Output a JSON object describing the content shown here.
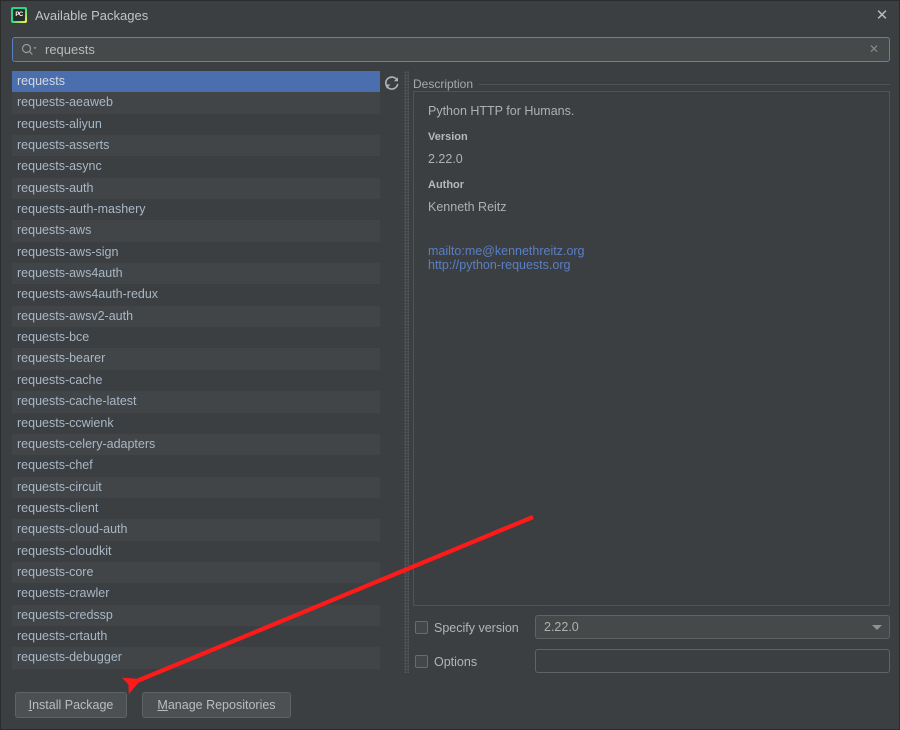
{
  "window": {
    "title": "Available Packages",
    "app_icon": "pycharm-icon",
    "close_icon": "close-icon"
  },
  "search": {
    "icon": "search-icon",
    "value": "requests",
    "placeholder": "",
    "clear_icon": "clear-icon"
  },
  "toolbar": {
    "refresh_icon": "refresh-icon"
  },
  "packages": {
    "selected": "requests",
    "items": [
      "requests",
      "requests-aeaweb",
      "requests-aliyun",
      "requests-asserts",
      "requests-async",
      "requests-auth",
      "requests-auth-mashery",
      "requests-aws",
      "requests-aws-sign",
      "requests-aws4auth",
      "requests-aws4auth-redux",
      "requests-awsv2-auth",
      "requests-bce",
      "requests-bearer",
      "requests-cache",
      "requests-cache-latest",
      "requests-ccwienk",
      "requests-celery-adapters",
      "requests-chef",
      "requests-circuit",
      "requests-client",
      "requests-cloud-auth",
      "requests-cloudkit",
      "requests-core",
      "requests-crawler",
      "requests-credssp",
      "requests-crtauth",
      "requests-debugger"
    ]
  },
  "description": {
    "group_label": "Description",
    "summary": "Python HTTP for Humans.",
    "version_label": "Version",
    "version_value": "2.22.0",
    "author_label": "Author",
    "author_value": "Kenneth Reitz",
    "links": [
      "mailto:me@kennethreitz.org",
      "http://python-requests.org"
    ]
  },
  "options": {
    "specify_version_label": "Specify version",
    "specify_version_checked": false,
    "version_selected": "2.22.0",
    "options_label": "Options",
    "options_checked": false,
    "options_value": "",
    "options_placeholder": ""
  },
  "buttons": {
    "install_mnemonic": "I",
    "install_rest": "nstall Package",
    "manage_mnemonic": "M",
    "manage_rest": "anage Repositories"
  },
  "colors": {
    "background": "#3c3f41",
    "selection": "#4b6eaf",
    "link": "#5a7fc4",
    "focus_border": "#5781c4",
    "annotation": "#ff1a1a"
  }
}
